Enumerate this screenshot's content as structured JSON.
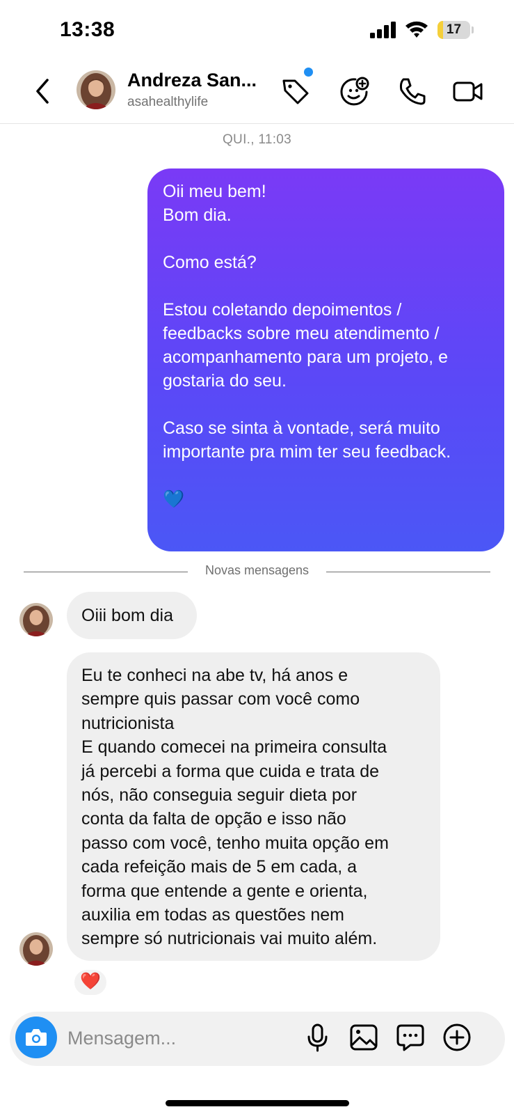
{
  "status_bar": {
    "time": "13:38",
    "battery_level": "17",
    "battery_fraction": 0.17
  },
  "header": {
    "contact_name": "Andreza San...",
    "contact_handle": "asahealthylife",
    "icons": [
      "chevron-left-icon",
      "tag-icon",
      "sticker-plus-icon",
      "phone-icon",
      "video-camera-icon"
    ],
    "notification_dot_color": "#1f8ff3"
  },
  "thread": {
    "timestamp": "QUI., 11:03",
    "sent_message": "Oii meu bem!\nBom dia.\n\nComo está?\n\nEstou coletando depoimentos /\nfeedbacks sobre meu atendimento /\nacompanhamento para um projeto, e\ngostaria do seu.\n\nCaso se sinta à vontade, será muito\nimportante pra mim ter seu feedback.\n\n💙",
    "divider_label": "Novas mensagens",
    "received_messages": [
      "Oiii bom dia",
      "Eu te conheci na abe tv, há anos e\nsempre quis passar com você como\nnutricionista\nE quando comecei na primeira consulta\njá percebi a forma que cuida e trata de\nnós, não conseguia seguir dieta por\nconta da falta de opção e isso não\npasso com você, tenho muita opção em\ncada refeição mais de 5 em cada, a\nforma que entende a gente e orienta,\nauxilia em todas as questões nem\nsempre só nutricionais vai muito além."
    ],
    "reaction": "❤️"
  },
  "composer": {
    "placeholder": "Mensagem...",
    "icons": [
      "camera-icon",
      "microphone-icon",
      "gallery-icon",
      "chat-bubble-icon",
      "plus-circle-icon"
    ]
  },
  "colors": {
    "sent_bubble_top": "#7a3af6",
    "sent_bubble_bottom": "#4b57f6",
    "received_bubble": "#efefef",
    "camera_button": "#1f8ff3",
    "battery_fill": "#f5cf3a"
  }
}
